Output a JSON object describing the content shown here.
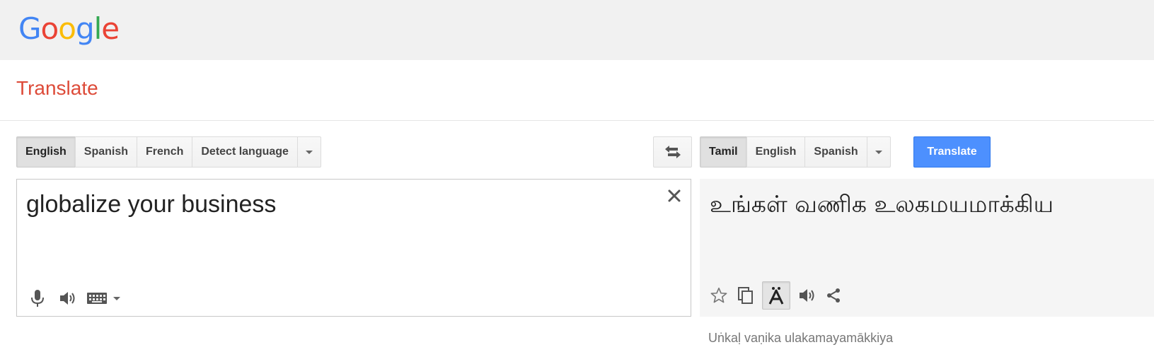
{
  "header": {
    "logo": [
      "G",
      "o",
      "o",
      "g",
      "l",
      "e"
    ],
    "logo_colors": [
      "#4285f4",
      "#ea4335",
      "#fbbc05",
      "#4285f4",
      "#34a853",
      "#ea4335"
    ]
  },
  "page": {
    "title": "Translate",
    "title_color": "#dd4b39"
  },
  "source_langs": {
    "options": [
      "English",
      "Spanish",
      "French",
      "Detect language"
    ],
    "selected": "English"
  },
  "target_langs": {
    "options": [
      "Tamil",
      "English",
      "Spanish"
    ],
    "selected": "Tamil"
  },
  "translate_button": {
    "label": "Translate",
    "color": "#4d90fe"
  },
  "source": {
    "text": "globalize your business",
    "tools": [
      "microphone-icon",
      "speaker-icon",
      "keyboard-icon",
      "chevron-down-icon"
    ]
  },
  "target": {
    "text": "உங்கள் வணிக உலகமயமாக்கிய",
    "tools": [
      "star-icon",
      "copy-icon",
      "phonetic-icon",
      "speaker-icon",
      "share-icon"
    ],
    "transliteration": "Uṅkaḷ vaṇika ulakamayamākkiya"
  },
  "clear_icon": "close-icon",
  "swap_icon": "swap-icon"
}
